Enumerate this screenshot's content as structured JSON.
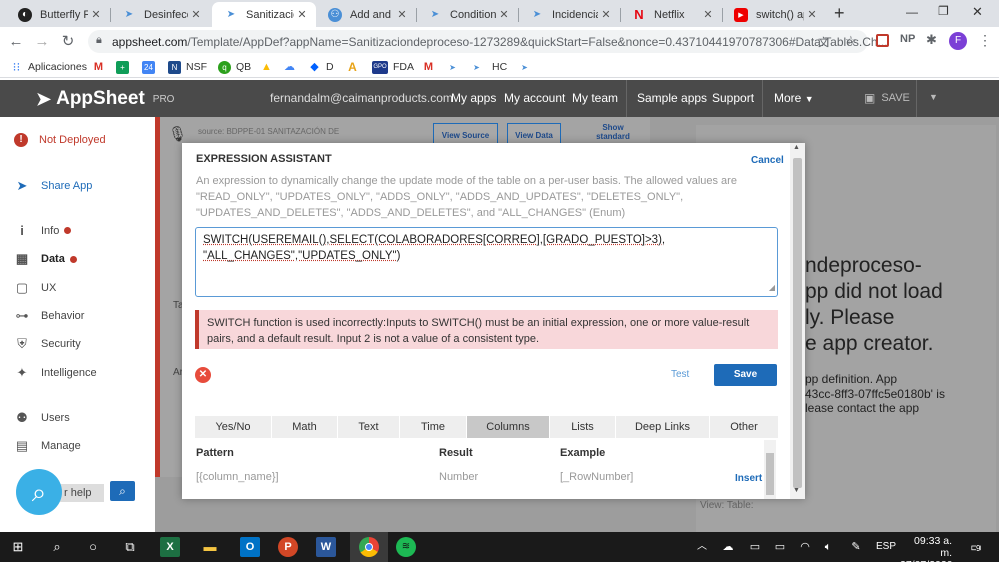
{
  "browser": {
    "tabs": [
      {
        "label": "Butterfly For",
        "icon": "butterfly-icon"
      },
      {
        "label": "Desinfección",
        "icon": "appsheet-icon"
      },
      {
        "label": "Sanitizacion",
        "icon": "appsheet-icon",
        "active": true
      },
      {
        "label": "Add and upd",
        "icon": "community-icon"
      },
      {
        "label": "Conditional",
        "icon": "appsheet-icon"
      },
      {
        "label": "Incidencias",
        "icon": "appsheet-icon"
      },
      {
        "label": "Netflix",
        "icon": "netflix-icon"
      },
      {
        "label": "switch() app",
        "icon": "youtube-icon"
      }
    ],
    "url_host": "appsheet.com",
    "url_path": "/Template/AppDef?appName=Sanitizaciondeproceso-1273289&quickStart=False&nonce=0.43710441970787306#Data.Tables.Ch...",
    "bookmarks": [
      "Aplicaciones",
      "NSF",
      "QB",
      "D",
      "FDA",
      "HC"
    ],
    "profile_letter": "F"
  },
  "header": {
    "logo": "AppSheet",
    "logo_suffix": "PRO",
    "email": "fernandalm@caimanproducts.com",
    "links": [
      "My apps",
      "My account",
      "My team",
      "Sample apps",
      "Support",
      "More"
    ],
    "save": "SAVE"
  },
  "sidebar": {
    "status": "Not Deployed",
    "share": "Share App",
    "items": [
      {
        "label": "Info",
        "icon": "info-icon",
        "dot": true
      },
      {
        "label": "Data",
        "icon": "grid-icon",
        "dot": true,
        "active": true
      },
      {
        "label": "UX",
        "icon": "ux-icon"
      },
      {
        "label": "Behavior",
        "icon": "hierarchy-icon"
      },
      {
        "label": "Security",
        "icon": "shield-icon"
      },
      {
        "label": "Intelligence",
        "icon": "bulb-icon"
      },
      {
        "label": "Users",
        "icon": "users-icon"
      },
      {
        "label": "Manage",
        "icon": "briefcase-icon"
      }
    ]
  },
  "background": {
    "source_label": "source: BDPPE-01 SANITAZACIÓN DE",
    "view_source": "View Source",
    "view_data": "View Data",
    "show_standard": "Show standard",
    "error_lines": [
      "ndeproceso-",
      "pp did not load",
      "ly. Please",
      "e app creator."
    ],
    "error_small": [
      "pp definition. App",
      "43cc-8ff3-07ffc5e0180b' is",
      "lease contact the app"
    ],
    "for_help": "r help",
    "view_table": "View:   Table:"
  },
  "modal": {
    "title": "EXPRESSION ASSISTANT",
    "cancel": "Cancel",
    "description": "An expression to dynamically change the update mode of the table on a per-user basis. The allowed values are \"READ_ONLY\", \"UPDATES_ONLY\", \"ADDS_ONLY\", \"ADDS_AND_UPDATES\", \"DELETES_ONLY\", \"UPDATES_AND_DELETES\", \"ADDS_AND_DELETES\", and \"ALL_CHANGES\" (Enum)",
    "expression_line1": "SWITCH(USEREMAIL(),SELECT(COLABORADORES[CORREO],[GRADO_PUESTO]>3),",
    "expression_line2": "\"ALL_CHANGES\",\"UPDATES_ONLY\")",
    "error": "SWITCH function is used incorrectly:Inputs to SWITCH() must be an initial expression, one or more value-result pairs, and a default result. Input 2 is not a value of a consistent type.",
    "test": "Test",
    "save": "Save",
    "tabs": [
      "Yes/No",
      "Math",
      "Text",
      "Time",
      "Columns",
      "Lists",
      "Deep Links",
      "Other"
    ],
    "selected_tab": "Columns",
    "columns": [
      "Pattern",
      "Result",
      "Example"
    ],
    "row": {
      "pattern": "[{column_name}]",
      "result": "Number",
      "example": "[_RowNumber]",
      "action": "Insert"
    }
  },
  "taskbar": {
    "lang": "ESP",
    "time": "09:33 a. m.",
    "date": "27/07/2020",
    "notif": "9"
  },
  "colors": {
    "accent": "#1e6bb8",
    "error": "#c0392b",
    "header": "#4a4a4a"
  }
}
